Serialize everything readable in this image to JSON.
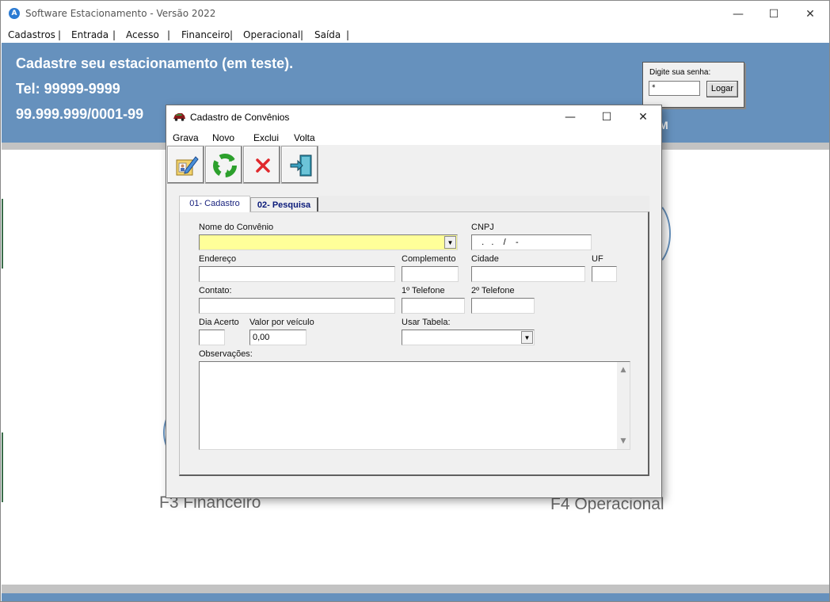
{
  "window": {
    "title": "Software Estacionamento - Versão 2022",
    "controls": {
      "minimize": "—",
      "maximize": "☐",
      "close": "✕"
    }
  },
  "menu": {
    "items": [
      "Cadastros",
      "Entrada",
      "Acesso",
      "Financeiro",
      "Operacional",
      "Saída"
    ],
    "separator": "|"
  },
  "banner": {
    "line1": "Cadastre seu  estacionamento (em teste).",
    "line2": "Tel: 99999-9999",
    "line3": "99.999.999/0001-99",
    "partial_text": "M"
  },
  "login": {
    "label": "Digite sua senha:",
    "password_value": "*",
    "button": "Logar"
  },
  "background_labels": {
    "f3": "F3 Financeiro",
    "f4": "F4 Operacional"
  },
  "dialog": {
    "title": "Cadastro de Convênios",
    "controls": {
      "minimize": "—",
      "maximize": "☐",
      "close": "✕"
    },
    "menu": [
      "Grava",
      "Novo",
      "Exclui",
      "Volta"
    ],
    "toolbar": [
      {
        "name": "grava",
        "icon": "edit-record-icon"
      },
      {
        "name": "novo",
        "icon": "recycle-new-icon"
      },
      {
        "name": "exclui",
        "icon": "delete-x-icon"
      },
      {
        "name": "volta",
        "icon": "exit-door-icon"
      }
    ],
    "tabs": {
      "active": "01- Cadastro",
      "inactive": "02- Pesquisa"
    },
    "fields": {
      "nome_label": "Nome  do Convênio",
      "nome_value": "",
      "cnpj_label": "CNPJ",
      "cnpj_value": "   .   .    /    -",
      "endereco_label": "Endereço",
      "endereco_value": "",
      "complemento_label": "Complemento",
      "complemento_value": "",
      "cidade_label": "Cidade",
      "cidade_value": "",
      "uf_label": "UF",
      "uf_value": "",
      "contato_label": "Contato:",
      "contato_value": "",
      "tel1_label": "1º Telefone",
      "tel1_value": "",
      "tel2_label": "2º Telefone",
      "tel2_value": "",
      "dia_acerto_label": "Dia Acerto",
      "dia_acerto_value": "",
      "valor_label": "Valor  por veículo",
      "valor_value": "0,00",
      "usar_tabela_label": "Usar Tabela:",
      "usar_tabela_value": "",
      "observacoes_label": "Observações:",
      "observacoes_value": ""
    }
  },
  "colors": {
    "banner": "#6691bd",
    "dialog_bg": "#f0f0f0",
    "highlight_field": "#ffff99"
  }
}
